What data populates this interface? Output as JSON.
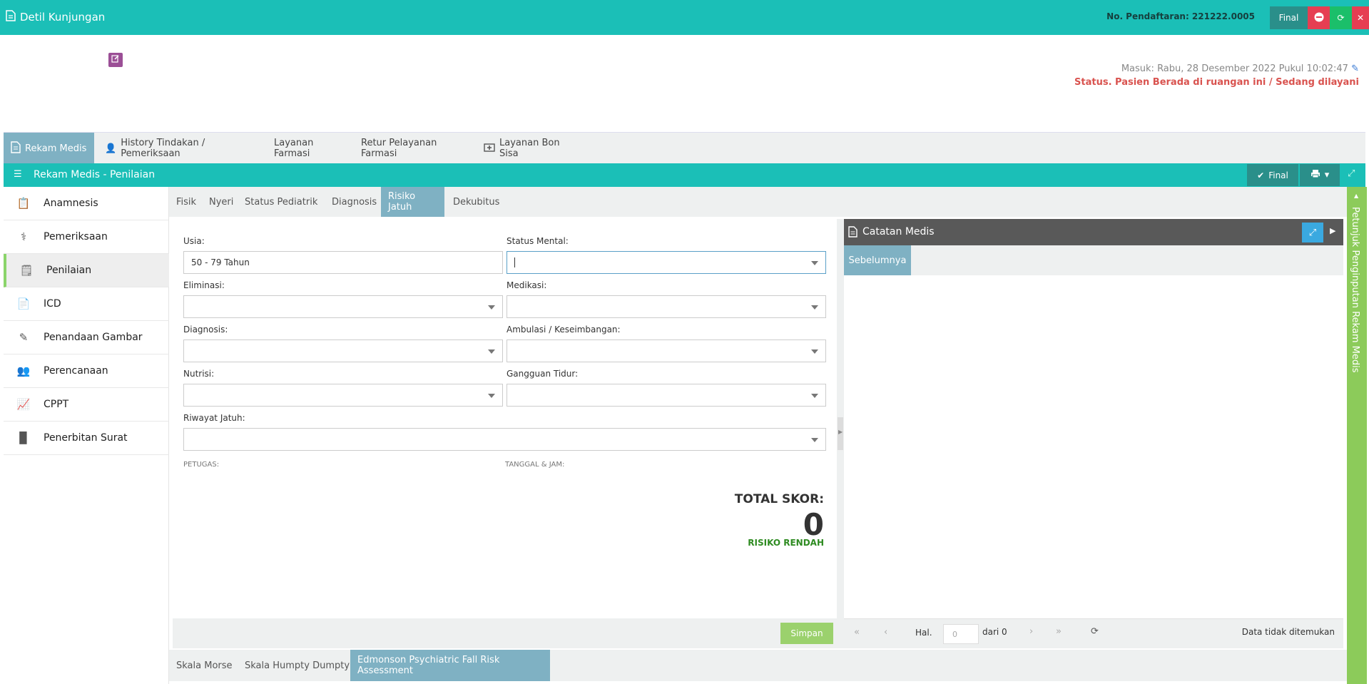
{
  "header": {
    "title": "Detil Kunjungan",
    "registration": "No. Pendaftaran: 221222.0005",
    "final_label": "Final",
    "colors": {
      "bar": "#1bbfb7",
      "final": "#2a8f8a",
      "minus": "#e63e52",
      "refresh": "#1bbf6a",
      "close": "#e63e52"
    }
  },
  "visit_info": {
    "masuk": "Masuk: Rabu, 28 Desember 2022 Pukul 10:02:47",
    "status": "Status. Pasien Berada di ruangan ini / Sedang dilayani"
  },
  "main_tabs": [
    {
      "label": "Rekam Medis",
      "icon": "document-icon",
      "active": true
    },
    {
      "label": "History Tindakan / Pemeriksaan",
      "icon": "user-history-icon",
      "active": false
    },
    {
      "label": "Layanan Farmasi",
      "icon": "",
      "active": false
    },
    {
      "label": "Retur Pelayanan Farmasi",
      "icon": "",
      "active": false
    },
    {
      "label": "Layanan Bon Sisa",
      "icon": "medkit-icon",
      "active": false
    }
  ],
  "section": {
    "title": "Rekam Medis - Penilaian",
    "final_label": "Final"
  },
  "left_nav": [
    {
      "label": "Anamnesis",
      "icon": "clipboard-icon"
    },
    {
      "label": "Pemeriksaan",
      "icon": "stethoscope-icon"
    },
    {
      "label": "Penilaian",
      "icon": "checklist-icon",
      "active": true
    },
    {
      "label": "ICD",
      "icon": "file-code-icon"
    },
    {
      "label": "Penandaan Gambar",
      "icon": "edit-icon"
    },
    {
      "label": "Perencanaan",
      "icon": "planning-icon"
    },
    {
      "label": "CPPT",
      "icon": "chart-icon"
    },
    {
      "label": "Penerbitan Surat",
      "icon": "file-icon"
    }
  ],
  "sub_tabs": [
    {
      "label": "Fisik"
    },
    {
      "label": "Nyeri"
    },
    {
      "label": "Status Pediatrik"
    },
    {
      "label": "Diagnosis"
    },
    {
      "label": "Risiko Jatuh",
      "active": true
    },
    {
      "label": "Dekubitus"
    }
  ],
  "form": {
    "usia": {
      "label": "Usia:",
      "value": "50 - 79 Tahun"
    },
    "status_mental": {
      "label": "Status Mental:",
      "value": ""
    },
    "eliminasi": {
      "label": "Eliminasi:",
      "value": ""
    },
    "medikasi": {
      "label": "Medikasi:",
      "value": ""
    },
    "diagnosis": {
      "label": "Diagnosis:",
      "value": ""
    },
    "ambulasi": {
      "label": "Ambulasi / Keseimbangan:",
      "value": ""
    },
    "nutrisi": {
      "label": "Nutrisi:",
      "value": ""
    },
    "gangguan_tidur": {
      "label": "Gangguan Tidur:",
      "value": ""
    },
    "riwayat_jatuh": {
      "label": "Riwayat Jatuh:",
      "value": ""
    },
    "petugas_label": "PETUGAS:",
    "tanggal_label": "TANGGAL & JAM:",
    "total_title": "TOTAL SKOR:",
    "total_value": "0",
    "risk_label": "RISIKO RENDAH",
    "save_label": "Simpan"
  },
  "bottom_tabs": [
    {
      "label": "Skala Morse"
    },
    {
      "label": "Skala Humpty Dumpty"
    },
    {
      "label": "Edmonson Psychiatric Fall Risk Assessment",
      "active": true
    }
  ],
  "catatan": {
    "title": "Catatan Medis",
    "tab_label": "Sebelumnya",
    "page_label": "Hal.",
    "page_value": "0",
    "of_label": "dari 0",
    "empty_text": "Data tidak ditemukan"
  },
  "guide_label": "Petunjuk Penginputan Rekam Medis"
}
